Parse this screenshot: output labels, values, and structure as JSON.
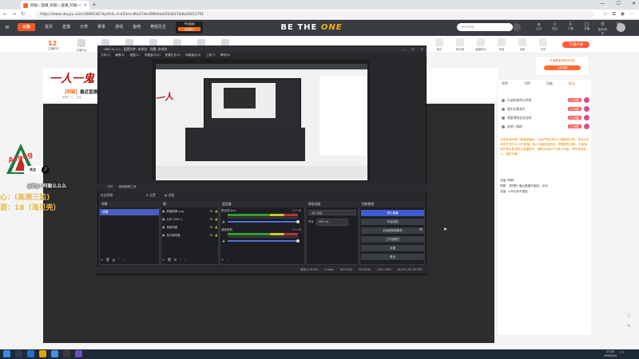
{
  "browser": {
    "tab_title": "阿聪一直播_阿聪一直播_阿聪一三…",
    "url": "https://www.douyu.com/10895367dyshid=0-b53ea-8fa27abd9f8dde026a827b4b20011701",
    "win_min": "—",
    "win_max": "☐",
    "win_close": "✕"
  },
  "douyu": {
    "logo": "斗鱼",
    "nav": [
      "首页",
      "直播",
      "分类",
      "赛事",
      "游戏",
      "鱼吧",
      "艳姐先生"
    ],
    "activity_top": "PGI活动",
    "activity_btn": "点击参与",
    "banner_a": "BE THE ",
    "banner_b": "ONE",
    "search_placeholder": "sein对战",
    "icons": [
      {
        "glyph": "⌂",
        "label": "主页"
      },
      {
        "glyph": "☆",
        "label": "关注"
      },
      {
        "glyph": "⇩",
        "label": "下载"
      },
      {
        "glyph": "▢",
        "label": "开播"
      },
      {
        "glyph": "⏱",
        "label": "鱼吧/历史"
      },
      {
        "glyph": "✉",
        "label": "消息"
      }
    ]
  },
  "room": {
    "level": "12",
    "level_label": "主播积分",
    "categories": [
      "主播平台",
      "弹幕",
      "关注",
      "举报",
      "分享",
      "分类",
      "礼物"
    ],
    "title_prefix": "【阿聪】",
    "title": "最近直播...",
    "sub": "阿聪一三 · 分区",
    "right_gifts": [
      "鱼丸",
      "粉丝团",
      "超级粉丝",
      "贵族",
      "钻粉",
      "分享"
    ],
    "pc_btn": "PC客户端",
    "promo_text": "开通看宝和更多特权",
    "promo_btn": "点击领取"
  },
  "chat": {
    "tabs": [
      "周榜",
      "月榜",
      "贡献",
      "粉丝"
    ],
    "fans": [
      {
        "name": "乐湖的弱鸡大师哥",
        "badge": "20 阿聪"
      },
      {
        "name": "渥尔必看来生",
        "badge": "20 阿聪"
      },
      {
        "name": "我要增粉丝加油吧",
        "badge": "20 阿聪"
      },
      {
        "name": "波湖 / 微粉",
        "badge": "20 阿聪"
      }
    ],
    "notice": "欢迎来到阿聪一直播直播间，斗鱼严禁未成年人直播或打赏，请勿以任何形式进行24小时直播，禁止传播违规信息，提倡理性消费。本直播间严禁出售或转让直播账号，谨慎对待私下交易与充值，请勿轻信他人，谨防诈骗。",
    "line1_user": "流量: 阿聪:",
    "line2_user": "阿聪:",
    "line2_text": "【阿聪】最近直播不固定，见谅",
    "line3_user": "流量:",
    "line3_text": "少年吐老不惑型"
  },
  "obs": {
    "title": "OBS 31.0.1 - 配置文件: 未命名 - 场景: 未命名",
    "menu": [
      "文件(F)",
      "编辑(E)",
      "视图(V)",
      "停靠窗口(D)",
      "配置文件(P)",
      "场景集合(S)",
      "工具(T)",
      "帮助(H)"
    ],
    "tools_label": "OBS",
    "tools_items": [
      "画面编辑工具"
    ],
    "no_source": "未选择源",
    "props": "⚙ 设置",
    "filters": "▤ 滤镜",
    "scenes_title": "场景",
    "scene_selected": "场景",
    "sources_title": "源",
    "sources": [
      "新建图像.png",
      "文本 (GDI+)",
      "音频采集",
      "显示器采集"
    ],
    "mixer_title": "混音器",
    "mixer": [
      {
        "label": "麦克风/Aux",
        "db": "0.0 dB"
      },
      {
        "label": "桌面音频",
        "db": "0.0 dB"
      }
    ],
    "trans_title": "转场动画",
    "trans_value": "淡入淡出",
    "trans_dur_label": "时长",
    "trans_dur_value": "300 ms",
    "ctrl_title": "控制按钮",
    "controls": [
      "停止直播",
      "开始录制",
      "启动虚拟摄像机",
      "工作室模式",
      "设置",
      "退出"
    ],
    "status": [
      "丢帧 0 (0.0%)",
      "0 kbps",
      "00:00:00",
      "00:00:00",
      "CPU: 0.8%",
      "60.00 / 60.00 FPS"
    ]
  },
  "overlay": {
    "follow": "关注",
    "dy_handle": "@Dy: 阿聪么么么",
    "line1": "心：(高潮三监)",
    "line2": "涯：18（海贝壳）"
  },
  "taskbar": {
    "time": "17:53",
    "date": "2025/4/4"
  }
}
